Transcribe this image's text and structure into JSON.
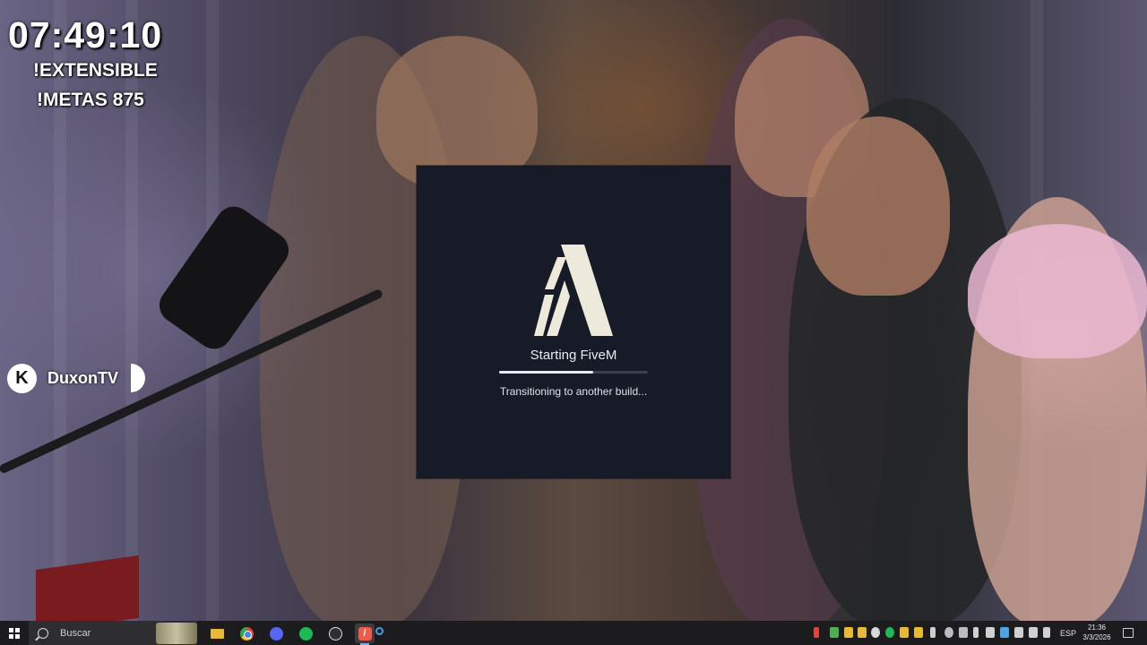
{
  "overlay": {
    "timer": "07:49:10",
    "command_1": "!EXTENSIBLE",
    "command_2": "!METAS 875",
    "platform_badge": "K",
    "channel_name": "DuxonTV"
  },
  "splash": {
    "app_icon": "fivem-logo-icon",
    "title": "Starting FiveM",
    "progress": 0.63,
    "status": "Transitioning to another build..."
  },
  "taskbar": {
    "start_icon": "windows-start-icon",
    "search_placeholder": "Buscar",
    "apps": [
      {
        "name": "file-explorer-icon",
        "color": "#e8b935"
      },
      {
        "name": "chrome-icon",
        "color": "#4285f4"
      },
      {
        "name": "discord-icon",
        "color": "#5865f2"
      },
      {
        "name": "spotify-icon",
        "color": "#1db954"
      },
      {
        "name": "obs-studio-icon",
        "color": "#302e31"
      },
      {
        "name": "fivem-icon",
        "color": "#f05a4a"
      }
    ],
    "language": "ESP",
    "time": "21:36",
    "date": "3/3/2026"
  }
}
